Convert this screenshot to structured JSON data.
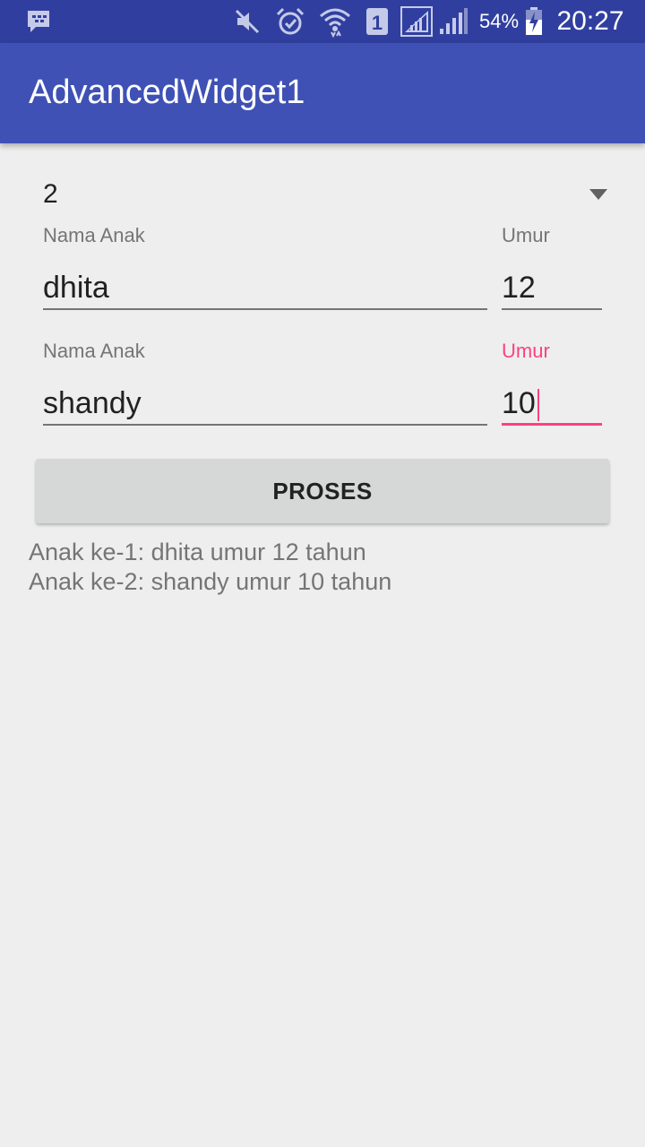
{
  "status_bar": {
    "icons": [
      "bbm-icon",
      "mute-icon",
      "alarm-icon",
      "wifi-icon",
      "sim1-icon",
      "signal-sim1-icon",
      "signal-sim2-icon",
      "battery-charging-icon"
    ],
    "battery_percent": "54%",
    "time": "20:27",
    "background": "#303f9f"
  },
  "app_bar": {
    "title": "AdvancedWidget1",
    "background": "#3f51b5"
  },
  "spinner": {
    "selected": "2"
  },
  "children": [
    {
      "name_label": "Nama Anak",
      "name_value": "dhita",
      "age_label": "Umur",
      "age_value": "12"
    },
    {
      "name_label": "Nama Anak",
      "name_value": "shandy",
      "age_label": "Umur",
      "age_value": "10"
    }
  ],
  "button": {
    "label": "PROSES"
  },
  "result": {
    "lines": [
      "Anak ke-1: dhita umur 12 tahun",
      "Anak ke-2: shandy umur 10 tahun"
    ]
  },
  "colors": {
    "accent": "#ff4081",
    "primary": "#3f51b5",
    "primary_dark": "#303f9f"
  }
}
